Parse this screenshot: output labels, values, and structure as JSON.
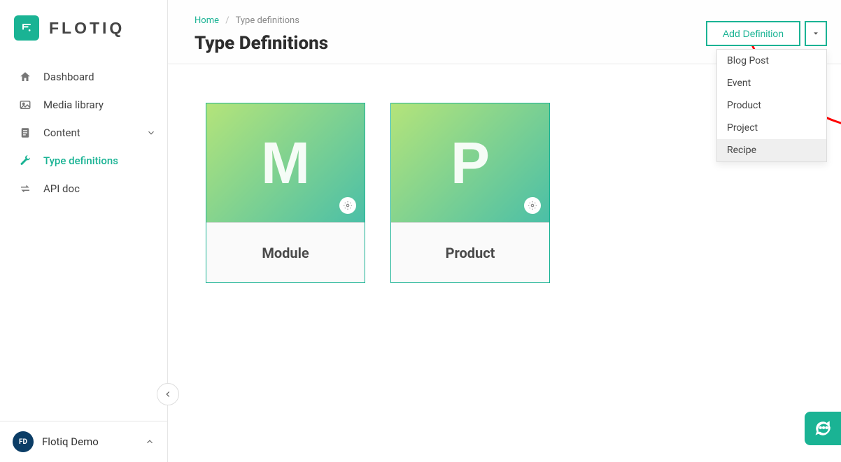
{
  "brand": {
    "name": "FLOTIQ"
  },
  "sidebar": {
    "items": [
      {
        "label": "Dashboard"
      },
      {
        "label": "Media library"
      },
      {
        "label": "Content"
      },
      {
        "label": "Type definitions"
      },
      {
        "label": "API doc"
      }
    ]
  },
  "user": {
    "initials": "FD",
    "name": "Flotiq Demo"
  },
  "breadcrumb": {
    "home": "Home",
    "current": "Type definitions"
  },
  "page": {
    "title": "Type Definitions"
  },
  "actions": {
    "add_definition": "Add Definition",
    "options": [
      {
        "label": "Blog Post"
      },
      {
        "label": "Event"
      },
      {
        "label": "Product"
      },
      {
        "label": "Project"
      },
      {
        "label": "Recipe"
      }
    ]
  },
  "cards": [
    {
      "letter": "M",
      "title": "Module"
    },
    {
      "letter": "P",
      "title": "Product"
    }
  ]
}
